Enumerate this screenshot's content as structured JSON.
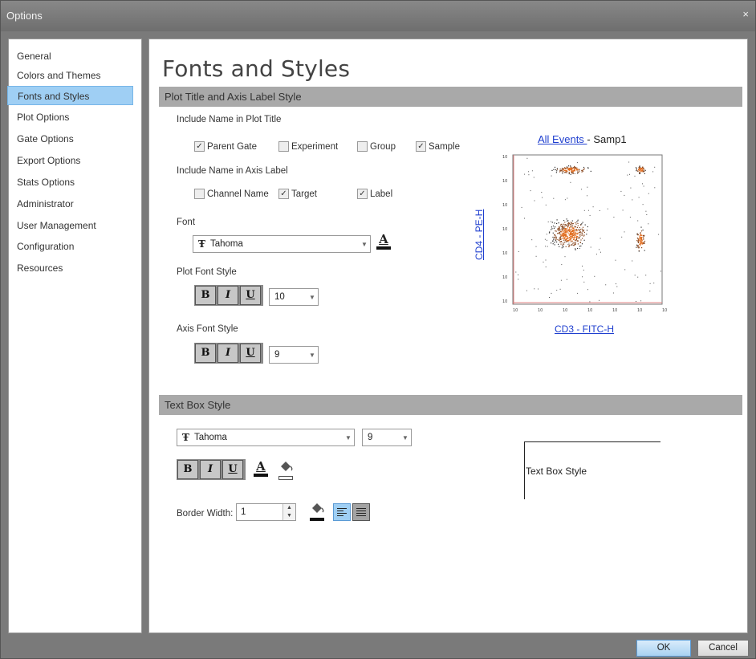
{
  "window": {
    "title": "Options",
    "close_glyph": "×"
  },
  "sidebar": {
    "items": [
      {
        "label": "General"
      },
      {
        "label": "Colors and Themes"
      },
      {
        "label": "Fonts and Styles",
        "active": true
      },
      {
        "label": "Plot Options"
      },
      {
        "label": "Gate Options"
      },
      {
        "label": "Export Options"
      },
      {
        "label": "Stats Options"
      },
      {
        "label": "Administrator"
      },
      {
        "label": "User Management"
      },
      {
        "label": "Configuration"
      },
      {
        "label": "Resources"
      }
    ]
  },
  "page": {
    "title": "Fonts and Styles"
  },
  "plot_section": {
    "header": "Plot Title and Axis Label Style",
    "title_label": "Include Name in Plot Title",
    "title_checks": [
      {
        "label": "Parent Gate",
        "checked": true
      },
      {
        "label": "Experiment",
        "checked": false
      },
      {
        "label": "Group",
        "checked": false
      },
      {
        "label": "Sample",
        "checked": true
      }
    ],
    "axis_label": "Include Name in Axis Label",
    "axis_checks": [
      {
        "label": "Channel Name",
        "checked": false
      },
      {
        "label": "Target",
        "checked": true
      },
      {
        "label": "Label",
        "checked": true
      }
    ],
    "font_label": "Font",
    "font_value": "Tahoma",
    "plot_font_style_label": "Plot Font Style",
    "plot_font_size": "10",
    "axis_font_style_label": "Axis Font Style",
    "axis_font_size": "9",
    "bold": "B",
    "italic": "I",
    "underline": "U",
    "font_color_glyph": "A"
  },
  "preview_plot": {
    "title_link": "All Events ",
    "title_rest": "- Samp1",
    "x_label": "CD3 - FITC-H",
    "y_label": "CD4 - PE-H",
    "x_ticks": [
      "10",
      "10",
      "10",
      "10",
      "10",
      "10",
      "10"
    ],
    "y_ticks": [
      "10",
      "10",
      "10",
      "10",
      "10",
      "10",
      "10"
    ]
  },
  "textbox_section": {
    "header": "Text Box Style",
    "font_value": "Tahoma",
    "font_size": "9",
    "bold": "B",
    "italic": "I",
    "underline": "U",
    "font_color_glyph": "A",
    "border_width_label": "Border Width:",
    "border_width": "1",
    "preview_text": "Text Box Style"
  },
  "footer": {
    "ok": "OK",
    "cancel": "Cancel"
  },
  "colors": {
    "accent": "#9fcff4",
    "header_gray": "#a9a9a9",
    "link": "#1f3fcf",
    "checked_align": "#77b6e8"
  }
}
